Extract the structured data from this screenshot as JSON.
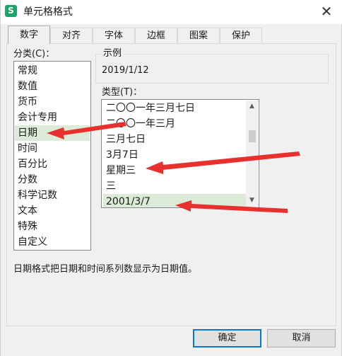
{
  "window": {
    "app_icon": "S",
    "title": "单元格格式",
    "close_glyph": "✕"
  },
  "tabs": [
    {
      "label": "数字",
      "active": true
    },
    {
      "label": "对齐",
      "active": false
    },
    {
      "label": "字体",
      "active": false
    },
    {
      "label": "边框",
      "active": false
    },
    {
      "label": "图案",
      "active": false
    },
    {
      "label": "保护",
      "active": false
    }
  ],
  "category": {
    "label": "分类(C)：",
    "items": [
      "常规",
      "数值",
      "货币",
      "会计专用",
      "日期",
      "时间",
      "百分比",
      "分数",
      "科学记数",
      "文本",
      "特殊",
      "自定义"
    ],
    "selected": "日期"
  },
  "sample": {
    "label": "示例",
    "value": "2019/1/12"
  },
  "type": {
    "label": "类型(T)：",
    "items": [
      "二〇〇一年三月七日",
      "二〇〇一年三月",
      "三月七日",
      "3月7日",
      "星期三",
      "三",
      "2001/3/7"
    ],
    "selected": "2001/3/7",
    "scroll_up": "▲",
    "scroll_down": "▼"
  },
  "description": "日期格式把日期和时间系列数显示为日期值。",
  "buttons": {
    "ok": "确定",
    "cancel": "取消"
  },
  "colors": {
    "selection": "#dcebd8",
    "annotation_arrow": "#e8312f",
    "app_icon": "#1aa56a"
  }
}
